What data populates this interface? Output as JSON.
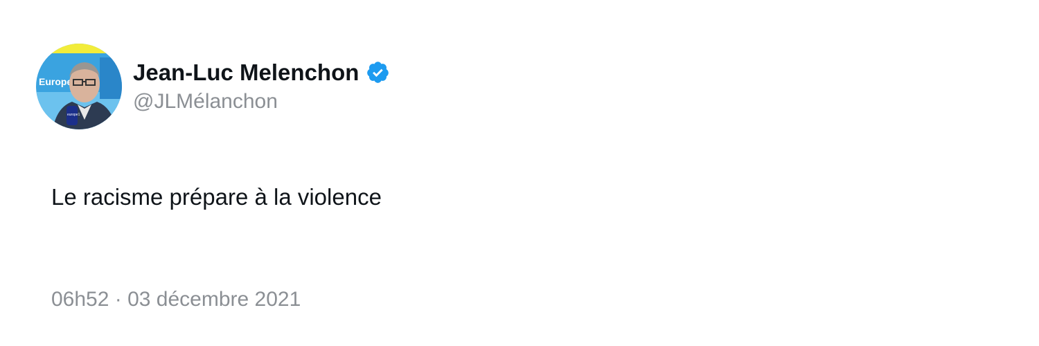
{
  "tweet": {
    "author": {
      "display_name": "Jean-Luc Melenchon",
      "handle": "@JLMélanchon",
      "verified": true,
      "avatar_icon": "profile-photo",
      "avatar_logo_text": "Europe1"
    },
    "text": "Le racisme prépare à la violence",
    "timestamp": "06h52 · 03 décembre 2021"
  },
  "colors": {
    "background": "#ffffff",
    "text": "#0f1419",
    "muted": "#8b8f94",
    "verified_badge": "#1d9bf0"
  }
}
